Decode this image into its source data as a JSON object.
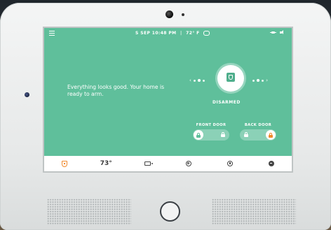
{
  "status_bar": {
    "day": "S",
    "month": "SEP",
    "time": "10:48 PM",
    "separator": "|",
    "temperature": "72° F"
  },
  "icons": {
    "menu": "menu-icon",
    "cloud": "cloud-icon",
    "power": "plug-icon",
    "volume": "volume-icon",
    "arm_shield": "shield-icon",
    "lock": "lock-icon"
  },
  "main": {
    "message": "Everything looks good. Your home is ready to arm.",
    "arm_state": "DISARMED"
  },
  "doors": [
    {
      "label": "FRONT DOOR"
    },
    {
      "label": "BACK DOOR"
    }
  ],
  "tabbar": {
    "temperature": "73°"
  },
  "colors": {
    "screen": "#5fbf9b",
    "accent": "#f08a2c"
  }
}
